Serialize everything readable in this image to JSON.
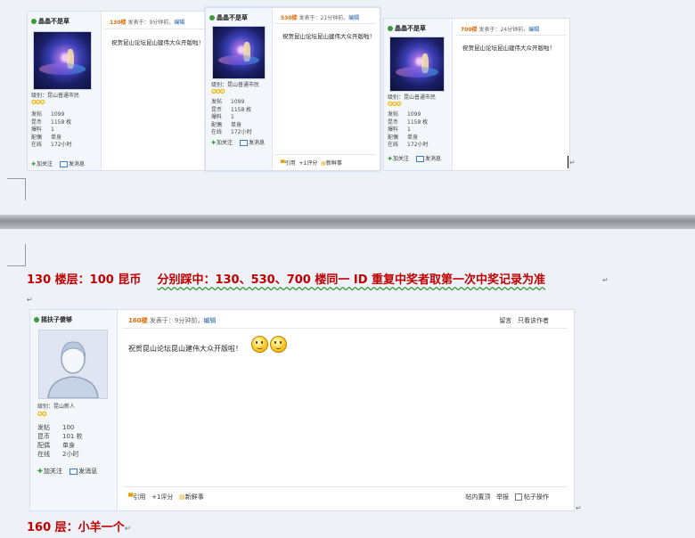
{
  "captions": {
    "line1": "130 楼层：100 昆币",
    "line1b": "分别踩中：130、530、700 楼同一 ID 重复中奖者取第一次中奖记录为准",
    "line2": "160 层：小羊一个"
  },
  "posts_top": [
    {
      "username": "晶晶不是草",
      "level": "级别：昆山普通市民",
      "stars": "✪✪✪",
      "stats": [
        {
          "k": "发帖",
          "v": "1099"
        },
        {
          "k": "昆币",
          "v": "1158 枚"
        },
        {
          "k": "爆料",
          "v": "1"
        },
        {
          "k": "配偶",
          "v": "单身"
        },
        {
          "k": "在线",
          "v": "172小时"
        }
      ],
      "follow": "加关注",
      "message": "发消息",
      "floor": "130楼",
      "posted": "发表于：9分钟前，",
      "edit": "编辑",
      "content": "祝贺昆山论坛昆山建伟大众开版啦！"
    },
    {
      "username": "晶晶不是草",
      "level": "级别：昆山普通市民",
      "stars": "✪✪✪",
      "stats": [
        {
          "k": "发帖",
          "v": "1099"
        },
        {
          "k": "昆币",
          "v": "1158 枚"
        },
        {
          "k": "爆料",
          "v": "1"
        },
        {
          "k": "配偶",
          "v": "单身"
        },
        {
          "k": "在线",
          "v": "172小时"
        }
      ],
      "follow": "加关注",
      "message": "发消息",
      "floor": "530楼",
      "posted": "发表于：21分钟前，",
      "edit": "编辑",
      "content": "祝贺昆山论坛昆山建伟大众开版啦！",
      "footer": {
        "quote": "引用",
        "rate": "+1评分",
        "fresh": "新鲜事"
      }
    },
    {
      "username": "晶晶不是草",
      "level": "级别：昆山普通市民",
      "stars": "✪✪✪",
      "stats": [
        {
          "k": "发帖",
          "v": "1099"
        },
        {
          "k": "昆币",
          "v": "1158 枚"
        },
        {
          "k": "爆料",
          "v": "1"
        },
        {
          "k": "配偶",
          "v": "单身"
        },
        {
          "k": "在线",
          "v": "172小时"
        }
      ],
      "follow": "加关注",
      "message": "发消息",
      "floor": "700楼",
      "posted": "发表于：24分钟前，",
      "edit": "编辑",
      "content": "祝贺昆山论坛昆山建伟大众开版啦！"
    }
  ],
  "post_main": {
    "username": "摇扶子傻够",
    "level": "级别：昆山新人",
    "stars": "✪✪",
    "stats": [
      {
        "k": "发帖",
        "v": "100"
      },
      {
        "k": "昆币",
        "v": "101 枚"
      },
      {
        "k": "配偶",
        "v": "单身"
      },
      {
        "k": "在线",
        "v": "2小时"
      }
    ],
    "follow": "加关注",
    "message": "发消息",
    "floor": "160楼",
    "posted": "发表于：9分钟前，",
    "edit": "编辑",
    "right_links": [
      "留言",
      "只看该作者"
    ],
    "content": "祝贺昆山论坛昆山建伟大众开版啦！",
    "footer": {
      "quote": "引用",
      "rate": "+1评分",
      "fresh": "新鲜事",
      "top": "帖内置顶",
      "report": "举报",
      "op": "帖子操作"
    }
  },
  "marks": {
    "return": "↵"
  }
}
